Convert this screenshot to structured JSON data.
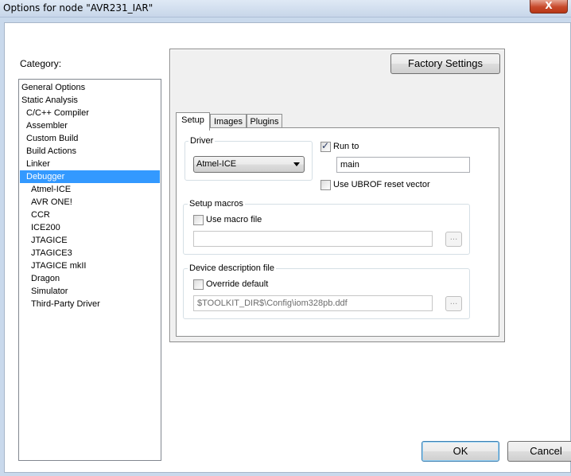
{
  "window": {
    "title": "Options for node \"AVR231_IAR\"",
    "close_glyph": "X"
  },
  "category": {
    "label": "Category:",
    "items": [
      {
        "label": "General Options",
        "selected": false
      },
      {
        "label": "Static Analysis",
        "selected": false
      },
      {
        "label": "C/C++ Compiler",
        "selected": false
      },
      {
        "label": "Assembler",
        "selected": false
      },
      {
        "label": "Custom Build",
        "selected": false
      },
      {
        "label": "Build Actions",
        "selected": false
      },
      {
        "label": "Linker",
        "selected": false
      },
      {
        "label": "Debugger",
        "selected": true
      },
      {
        "label": "Atmel-ICE",
        "selected": false
      },
      {
        "label": "AVR ONE!",
        "selected": false
      },
      {
        "label": "CCR",
        "selected": false
      },
      {
        "label": "ICE200",
        "selected": false
      },
      {
        "label": "JTAGICE",
        "selected": false
      },
      {
        "label": "JTAGICE3",
        "selected": false
      },
      {
        "label": "JTAGICE mkII",
        "selected": false
      },
      {
        "label": "Dragon",
        "selected": false
      },
      {
        "label": "Simulator",
        "selected": false
      },
      {
        "label": "Third-Party Driver",
        "selected": false
      }
    ]
  },
  "factory_settings_label": "Factory Settings",
  "tabs": [
    {
      "label": "Setup",
      "active": true
    },
    {
      "label": "Images",
      "active": false
    },
    {
      "label": "Plugins",
      "active": false
    }
  ],
  "setup": {
    "driver_group_label": "Driver",
    "driver_value": "Atmel-ICE",
    "run_to_label": "Run to",
    "run_to_checked": true,
    "run_to_value": "main",
    "ubrof_label": "Use UBROF reset vector",
    "ubrof_checked": false,
    "macros_group_label": "Setup macros",
    "use_macro_label": "Use macro file",
    "use_macro_checked": false,
    "macro_file_value": "",
    "browse_label": "...",
    "ddf_group_label": "Device description file",
    "override_label": "Override default",
    "override_checked": false,
    "ddf_value": "$TOOLKIT_DIR$\\Config\\iom328pb.ddf"
  },
  "buttons": {
    "ok_label": "OK",
    "cancel_label": "Cancel"
  },
  "colors": {
    "selection": "#3399ff",
    "panel_bg": "#f0f0f0",
    "frame": "#c9d9ec"
  }
}
